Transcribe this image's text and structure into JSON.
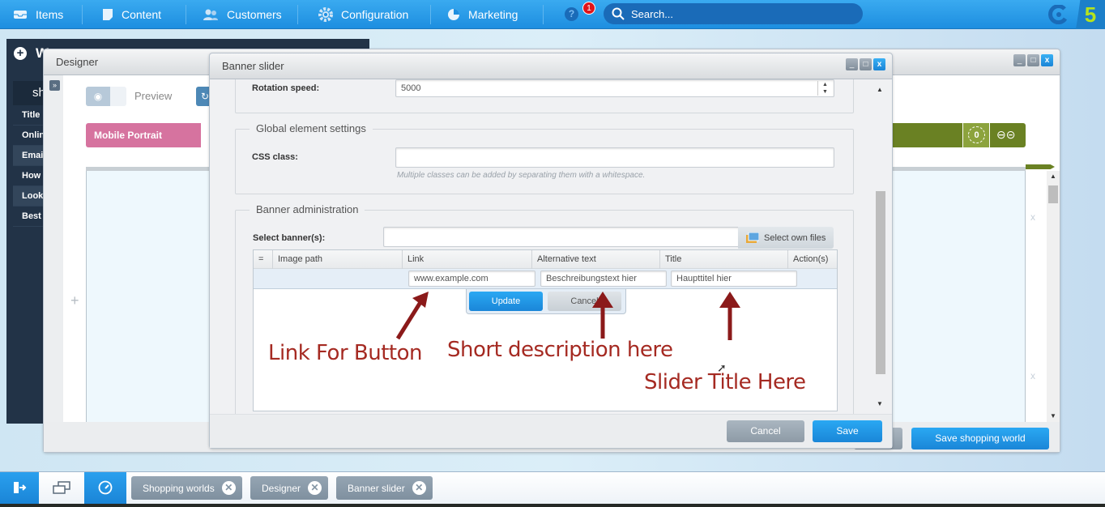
{
  "topbar": {
    "nav": [
      {
        "label": "Items",
        "icon": "inbox-icon"
      },
      {
        "label": "Content",
        "icon": "document-icon"
      },
      {
        "label": "Customers",
        "icon": "users-icon"
      },
      {
        "label": "Configuration",
        "icon": "gear-icon"
      },
      {
        "label": "Marketing",
        "icon": "pie-chart-icon"
      }
    ],
    "help_icon": "?",
    "notification_count": "1",
    "search_placeholder": "Search...",
    "brand_mark": "5"
  },
  "background_panel": {
    "title_initial": "W",
    "tab_label": "sh",
    "items": [
      "Title",
      "Onlin",
      "Emai",
      "How",
      "Look",
      "Best"
    ]
  },
  "designer": {
    "title": "Designer",
    "expand_icon": "»",
    "preview_label": "Preview",
    "device_label": "Mobile Portrait",
    "counter": "0",
    "save_world_label": "Save shopping world",
    "remove_marks": [
      "x",
      "x"
    ]
  },
  "banner_slider": {
    "title": "Banner slider",
    "rotation_speed_label": "Rotation speed:",
    "rotation_speed_value": "5000",
    "global_legend": "Global element settings",
    "css_class_label": "CSS class:",
    "css_class_value": "",
    "css_class_hint": "Multiple classes can be added by separating them with a whitespace.",
    "banner_admin_legend": "Banner administration",
    "select_banner_label": "Select banner(s):",
    "select_banner_value": "",
    "select_files_label": "Select own files",
    "grid": {
      "columns": [
        "=",
        "Image path",
        "Link",
        "Alternative text",
        "Title",
        "Action(s)"
      ],
      "edit_row": {
        "link": "www.example.com",
        "alt_text": "Beschreibungstext hier",
        "title": "Haupttitel hier"
      },
      "update_label": "Update",
      "cancel_label": "Cancel"
    },
    "annotations": {
      "link": "Link For Button",
      "description": "Short description here",
      "title": "Slider Title Here"
    },
    "cancel_label": "Cancel",
    "save_label": "Save"
  },
  "taskbar": {
    "tasks": [
      "Shopping worlds",
      "Designer",
      "Banner slider"
    ]
  },
  "colors": {
    "accent_blue": "#1d8ee0",
    "annotation_red": "#a52a22",
    "device_pink": "#d6739f",
    "device_green": "#6a8123"
  }
}
